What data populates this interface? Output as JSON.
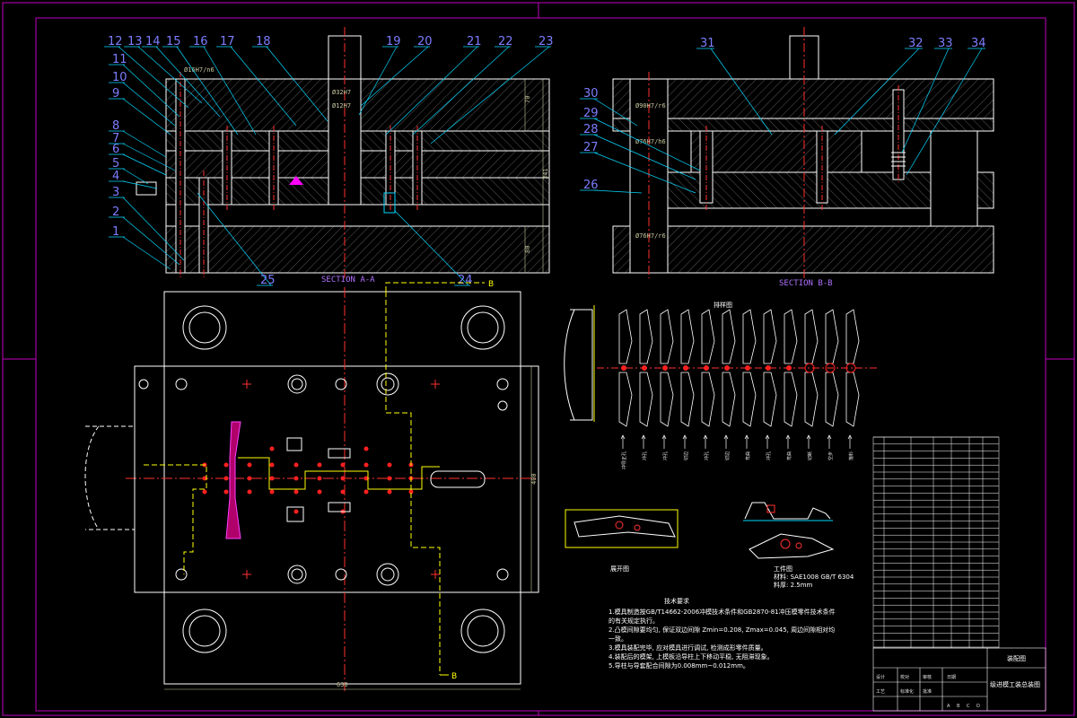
{
  "sheet": {
    "title": "",
    "frame_color": "#c000c0",
    "outline_color": "#ffffff",
    "leader_color": "#00d8ff",
    "hatch_color": "#7a7a7a",
    "center_color": "#ff3030",
    "strip_color": "#ffff00"
  },
  "section_a": {
    "title": "SECTION A-A",
    "part_numbers": [
      "1",
      "2",
      "3",
      "4",
      "5",
      "6",
      "7",
      "8",
      "9",
      "10",
      "11",
      "12",
      "13",
      "14",
      "15",
      "16",
      "17",
      "18",
      "19",
      "20",
      "21",
      "22",
      "23",
      "24",
      "25"
    ],
    "dims": {
      "h1": "70",
      "h_total": "341",
      "h2": "80",
      "fit_top": "Ø16H7/n6",
      "fit_a": "Ø32H7",
      "fit_b": "Ø12H7"
    }
  },
  "section_b": {
    "title": "SECTION B-B",
    "part_numbers": [
      "26",
      "27",
      "28",
      "29",
      "30",
      "31",
      "32",
      "33",
      "34"
    ],
    "dims": {
      "fit_1": "Ø90H7/r6",
      "fit_2": "Ø76H7/h6",
      "fit_3": "Ø76H7/r6"
    }
  },
  "plan_view": {
    "width_dim": "630",
    "height_dim": "400",
    "cut_marker_top": "B",
    "cut_marker_bottom": "B"
  },
  "strip_layout": {
    "title": "排样图",
    "station_labels": [
      "冲导正孔",
      "冲孔",
      "冲孔",
      "切边",
      "冲孔",
      "切边",
      "弯曲",
      "冲孔",
      "弯曲",
      "切断",
      "空步",
      "落料"
    ]
  },
  "blank": {
    "label": "展开图"
  },
  "workpiece": {
    "label": "工件图",
    "material": "材料: SAE1008 GB/T 6304",
    "thickness": "料厚: 2.5mm"
  },
  "tech_notes": {
    "heading": "技术要求",
    "lines": [
      "1.模具制造按GB/T14662-2006冲模技术条件和GB2870-81冲压模零件技术条件",
      "  的有关规定执行。",
      "2.凸模间隙要均匀, 保证双边间隙 Zmin=0.208, Zmax=0.045, 周边间隙相对均",
      "  一致。",
      "3.模具装配完毕, 应对模具进行调试, 检测成形零件质量。",
      "4.装配后的模架, 上模板沿导柱上下移动平稳, 无阻滞现象。",
      "5.导柱与导套配合间隙为0.008mm~0.012mm。"
    ]
  },
  "title_block": {
    "drawing_title": "装配图",
    "subtitle": "级进模工装总装图",
    "bottom_labels": [
      "设计",
      "校对",
      "审核",
      "工艺",
      "标准化",
      "批准",
      "日期"
    ],
    "scale_marks": [
      "A",
      "B",
      "C",
      "D"
    ]
  }
}
